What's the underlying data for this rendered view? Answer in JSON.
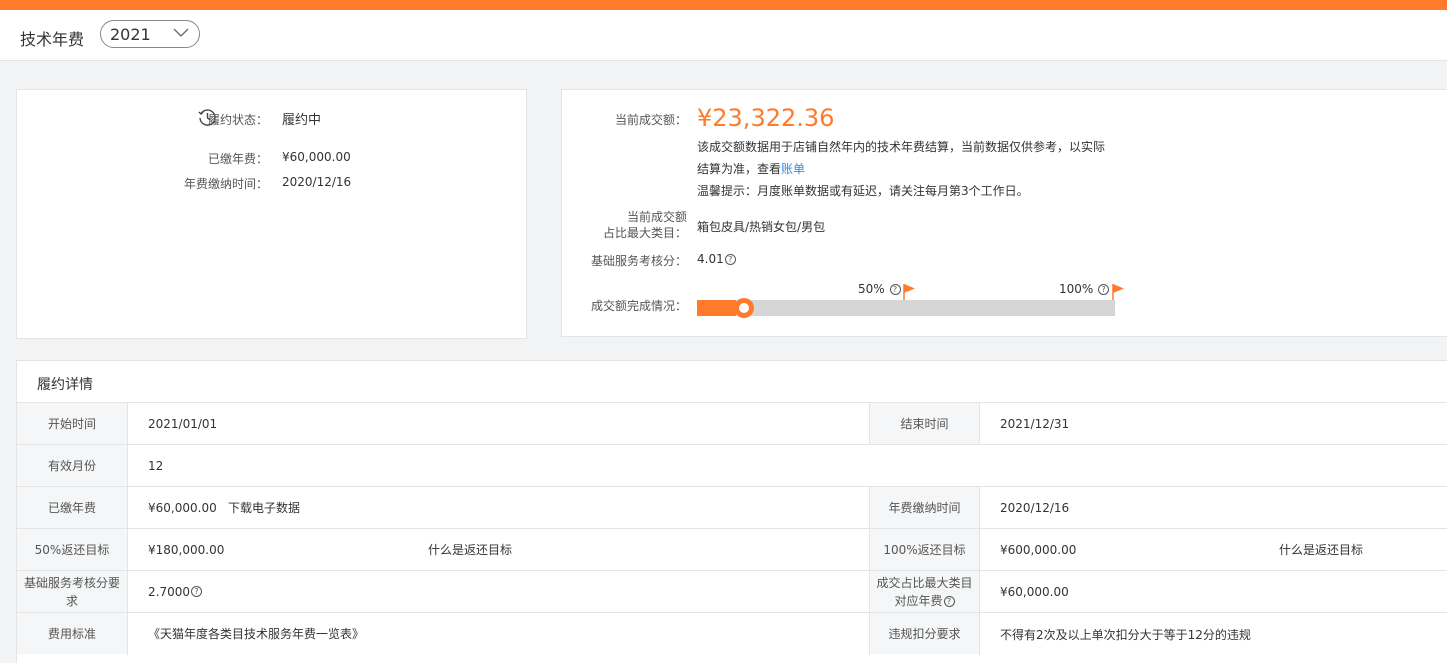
{
  "header": {
    "title": "技术年费",
    "year": "2021"
  },
  "status_card": {
    "status_label": "履约状态：",
    "status_value": "履约中",
    "paid_fee_label": "已缴年费：",
    "paid_fee_value": "¥60,000.00",
    "pay_time_label": "年费缴纳时间：",
    "pay_time_value": "2020/12/16"
  },
  "deal_card": {
    "amount_label": "当前成交额：",
    "amount_value": "¥23,322.36",
    "note_line1": "该成交额数据用于店铺自然年内的技术年费结算，当前数据仅供参考，以实际",
    "note_line2_prefix": "结算为准，查看",
    "note_link": "账单",
    "note_line3": "温馨提示：月度账单数据或有延迟，请关注每月第3个工作日。",
    "category_label_line1": "当前成交额",
    "category_label_line2": "占比最大类目：",
    "category_value": "箱包皮具/热销女包/男包",
    "score_label": "基础服务考核分：",
    "score_value": "4.01",
    "progress_label": "成交额完成情况：",
    "progress_fraction": 0.07,
    "mark_50": "50%",
    "mark_100": "100%",
    "accent_color": "#ff7a2a"
  },
  "detail": {
    "title": "履约详情",
    "start_label": "开始时间",
    "start_value": "2021/01/01",
    "end_label": "结束时间",
    "end_value": "2021/12/31",
    "months_label": "有效月份",
    "months_value": "12",
    "paid_label": "已缴年费",
    "paid_value": "¥60,000.00",
    "download_link": "下载电子数据",
    "paytime_label": "年费缴纳时间",
    "paytime_value": "2020/12/16",
    "target50_label": "50%返还目标",
    "target50_value": "¥180,000.00",
    "what_is_target": "什么是返还目标",
    "target100_label": "100%返还目标",
    "target100_value": "¥600,000.00",
    "score_req_label": "基础服务考核分要求",
    "score_req_value": "2.7000",
    "cat_fee_label_line1": "成交占比最大类目",
    "cat_fee_label_line2": "对应年费",
    "cat_fee_value": "¥60,000.00",
    "fee_std_label": "费用标准",
    "fee_std_link": "《天猫年度各类目技术服务年费一览表》",
    "violation_label": "违规扣分要求",
    "violation_value": "不得有2次及以上单次扣分大于等于12分的违规"
  }
}
